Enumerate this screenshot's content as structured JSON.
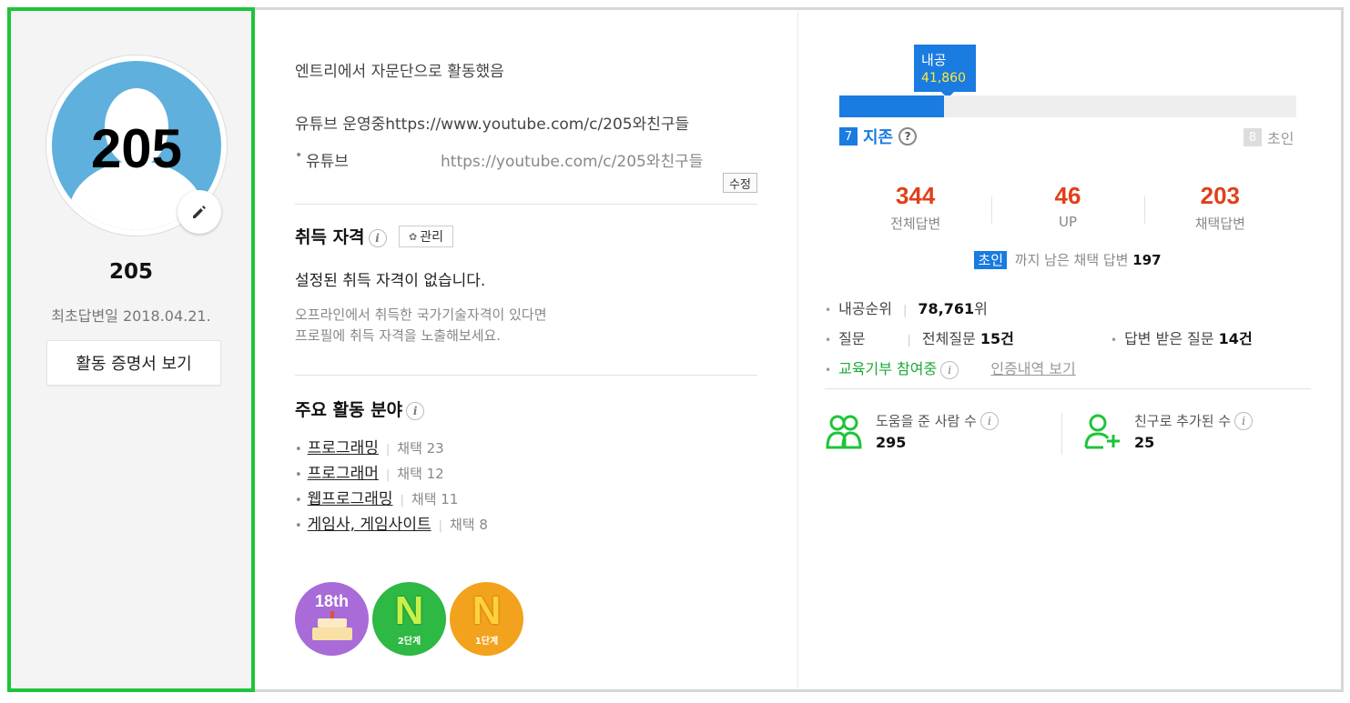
{
  "profile": {
    "avatar_text": "205",
    "nickname": "205",
    "first_answer_date": "최초답변일 2018.04.21.",
    "certificate_button": "활동 증명서 보기"
  },
  "intro": {
    "line1": "엔트리에서 자문단으로 활동했음",
    "line2": "유튜브 운영중https://www.youtube.com/c/205와친구들",
    "youtube_label": "유튜브",
    "youtube_url": "https://youtube.com/c/205와친구들",
    "modify_button": "수정"
  },
  "qualification": {
    "title": "취득 자격",
    "manage_button": "관리",
    "empty_text": "설정된 취득 자격이 없습니다.",
    "hint_line1": "오프라인에서 취득한 국가기술자격이 있다면",
    "hint_line2": "프로필에 취득 자격을 노출해보세요."
  },
  "fields": {
    "title": "주요 활동 분야",
    "items": [
      {
        "name": "프로그래밍",
        "count": "채택 23"
      },
      {
        "name": "프로그래머",
        "count": "채택 12"
      },
      {
        "name": "웹프로그래밍",
        "count": "채택 11"
      },
      {
        "name": "게임사, 게임사이트",
        "count": "채택 8"
      }
    ]
  },
  "badges": [
    {
      "top": "18th",
      "label": ""
    },
    {
      "big": "N",
      "label": "2단계"
    },
    {
      "big": "N",
      "label": "1단계"
    }
  ],
  "level": {
    "bubble_label": "내공",
    "bubble_value": "41,860",
    "progress_fraction": 0.23,
    "current_num": "7",
    "current_name": "지존",
    "next_num": "8",
    "next_name": "초인"
  },
  "stats": [
    {
      "value": "344",
      "label": "전체답변"
    },
    {
      "value": "46",
      "label": "UP"
    },
    {
      "value": "203",
      "label": "채택답변"
    }
  ],
  "remain": {
    "tag": "초인",
    "text": "까지 남은 채택 답변",
    "value": "197"
  },
  "rank": {
    "label": "내공순위",
    "value": "78,761",
    "unit": "위"
  },
  "questions": {
    "label": "질문",
    "total_label": "전체질문",
    "total_value": "15건",
    "answered_label": "답변 받은 질문",
    "answered_value": "14건"
  },
  "education": {
    "label": "교육기부 참여중",
    "link": "인증내역 보기"
  },
  "people": {
    "helped_label": "도움을 준 사람 수",
    "helped_value": "295",
    "friends_label": "친구로 추가된 수",
    "friends_value": "25"
  },
  "colors": {
    "accent_blue": "#1a7be0",
    "stat_red": "#e0401a",
    "green": "#1ec43a"
  }
}
